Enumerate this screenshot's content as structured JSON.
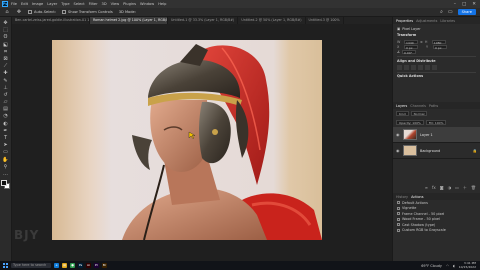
{
  "menubar": {
    "logo": "Ps",
    "items": [
      "File",
      "Edit",
      "Image",
      "Layer",
      "Type",
      "Select",
      "Filter",
      "3D",
      "View",
      "Plugins",
      "Window",
      "Help"
    ],
    "window_controls": [
      "–",
      "□",
      "✕"
    ]
  },
  "options_bar": {
    "auto_select_label": "Auto-Select:",
    "transform_label": "Show Transform Controls",
    "mode_label": "3D Mode:",
    "share_label": "Share"
  },
  "tabs": [
    {
      "label": "Ben-cartel-zeiss-jared-goldie-illustration-01 1680 1mr.psd @ 33.3% (Group 1, RGB/8)",
      "active": false
    },
    {
      "label": "Roman helmet 2.jpg @ 100% (Layer 1, RGB/8#)",
      "active": true
    },
    {
      "label": "Untitled-1 @ 33.3% (Layer 1, RGB/8#)",
      "active": false
    },
    {
      "label": "Untitled-2 @ 50% (Layer 1, RGB/8#)",
      "active": false
    },
    {
      "label": "Untitled-3 @ 100%",
      "active": false
    }
  ],
  "toolbar": {
    "tools": [
      "move-icon",
      "marquee-icon",
      "lasso-icon",
      "object-select-icon",
      "crop-icon",
      "frame-icon",
      "eyedropper-icon",
      "healing-icon",
      "brush-icon",
      "stamp-icon",
      "history-brush-icon",
      "eraser-icon",
      "gradient-icon",
      "blur-icon",
      "dodge-icon",
      "pen-icon",
      "type-icon",
      "path-select-icon",
      "rectangle-icon",
      "hand-icon",
      "zoom-icon",
      "more-icon"
    ],
    "foreground_color": "#111111",
    "background_color": "#ffffff"
  },
  "properties_panel": {
    "tabs": [
      "Properties",
      "Adjustments",
      "Libraries"
    ],
    "layer_type": "Pixel Layer",
    "transform_title": "Transform",
    "w_label": "W",
    "w_value": "1440 px",
    "h_label": "H",
    "h_value": "1080 px",
    "x_label": "X",
    "x_value": "0 px",
    "y_label": "Y",
    "y_value": "0 px",
    "angle_value": "0.00°",
    "align_title": "Align and Distribute",
    "quick_actions_title": "Quick Actions"
  },
  "layers_panel": {
    "tabs": [
      "Layers",
      "Channels",
      "Paths"
    ],
    "kind_label": "Kind",
    "blend_mode": "Normal",
    "opacity_label": "Opacity: 100%",
    "fill_label": "Fill: 100%",
    "layers": [
      {
        "name": "Layer 1",
        "selected": true
      },
      {
        "name": "Background",
        "selected": false
      }
    ],
    "footer_icons": [
      "link-icon",
      "fx-icon",
      "mask-icon",
      "adjustment-icon",
      "folder-icon",
      "new-layer-icon",
      "trash-icon"
    ]
  },
  "history_panel": {
    "tabs": [
      "History",
      "Actions"
    ],
    "items": [
      "Default Actions",
      "Vignette",
      "Frame Channel - 50 pixel",
      "Wood Frame - 50 pixel",
      "Cast Shadow (type)",
      "Custom RGB to Grayscale",
      "Molten Lead",
      "Sepia Toning (layer)"
    ]
  },
  "taskbar": {
    "search_placeholder": "Type here to search",
    "apps": [
      {
        "name": "taskbar-app-edge",
        "color": "#0f7bd8",
        "glyph": "e"
      },
      {
        "name": "taskbar-app-explorer",
        "color": "#e0a61a",
        "glyph": "▤"
      },
      {
        "name": "taskbar-app-chrome",
        "color": "#2e9a4f",
        "glyph": "●"
      },
      {
        "name": "taskbar-app-photoshop",
        "color": "#001e36",
        "glyph": "Ps"
      },
      {
        "name": "taskbar-app-illustrator",
        "color": "#330000",
        "glyph": "Ai"
      },
      {
        "name": "taskbar-app-premiere",
        "color": "#1d0033",
        "glyph": "Pr"
      },
      {
        "name": "taskbar-app-bridge",
        "color": "#3a2200",
        "glyph": "Br"
      }
    ],
    "weather": "69°F Cloudy",
    "time": "3:41 PM",
    "date": "10/15/2022"
  },
  "watermark": "BJY",
  "accent_color": "#31a8ff"
}
